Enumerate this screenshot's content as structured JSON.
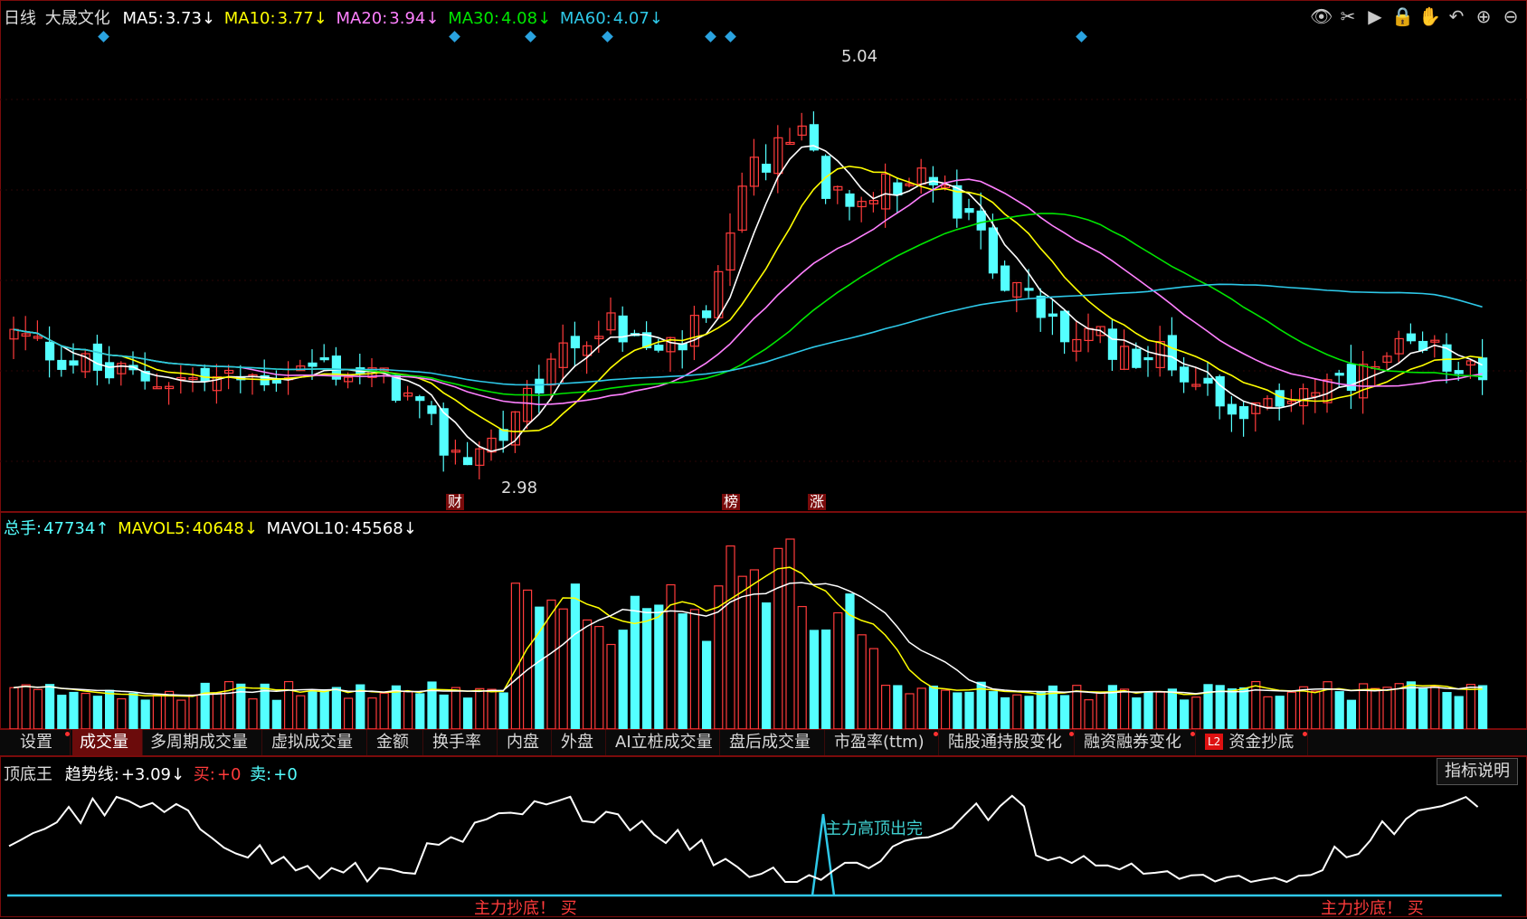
{
  "candle_header": {
    "period": "日线",
    "stock_name": "大晟文化",
    "ma5_label": "MA5:",
    "ma5_value": "3.73↓",
    "ma10_label": "MA10:",
    "ma10_value": "3.77↓",
    "ma20_label": "MA20:",
    "ma20_value": "3.94↓",
    "ma30_label": "MA30:",
    "ma30_value": "4.08↓",
    "ma60_label": "MA60:",
    "ma60_value": "4.07↓"
  },
  "candle_pane": {
    "high_label": "5.04",
    "low_label": "2.98",
    "event_tags": [
      "财",
      "榜",
      "涨"
    ]
  },
  "volume_header": {
    "total_label": "总手:",
    "total_value": "47734↑",
    "mavol5_label": "MAVOL5:",
    "mavol5_value": "40648↓",
    "mavol10_label": "MAVOL10:",
    "mavol10_value": "45568↓"
  },
  "tabs": [
    {
      "label": "设置",
      "dot": true
    },
    {
      "label": "成交量",
      "active": true
    },
    {
      "label": "多周期成交量"
    },
    {
      "label": "虚拟成交量"
    },
    {
      "label": "金额"
    },
    {
      "label": "换手率"
    },
    {
      "label": "内盘"
    },
    {
      "label": "外盘"
    },
    {
      "label": "AI立桩成交量"
    },
    {
      "label": "盘后成交量"
    },
    {
      "label": "市盈率(ttm)",
      "dot": true
    },
    {
      "label": "陆股通持股变化",
      "dot": true
    },
    {
      "label": "融资融券变化",
      "dot": true
    },
    {
      "label": "资金抄底",
      "badge": "L2",
      "dot": true
    }
  ],
  "indicator_header": {
    "name": "顶底王",
    "trend_label": "趋势线:",
    "trend_value": "+3.09↓",
    "buy_label": "买:",
    "buy_value": "+0",
    "sell_label": "卖:",
    "sell_value": "+0",
    "help_button": "指标说明"
  },
  "indicator_pane": {
    "signal_top": "主力高顶出完",
    "signal_bottom_1": "主力抄底！ 买",
    "signal_bottom_2": "主力抄底！ 买"
  },
  "toolbar_icons": [
    "eye-icon",
    "scissors-icon",
    "play-icon",
    "lock-icon",
    "hand-icon",
    "undo-icon",
    "zoom-in-icon",
    "zoom-out-icon"
  ],
  "colors": {
    "up": "#ff3b3b",
    "down": "#54ffff",
    "ma5": "#ffffff",
    "ma10": "#ffff00",
    "ma20": "#ff80ff",
    "ma30": "#00e600",
    "ma60": "#2ec8e8",
    "frame": "#7a0b0b"
  },
  "chart_data": {
    "type": "candlestick",
    "title": "大晟文化 日线",
    "price_high": 5.04,
    "price_low": 2.98,
    "ma_values": {
      "MA5": 3.73,
      "MA10": 3.77,
      "MA20": 3.94,
      "MA30": 4.08,
      "MA60": 4.07
    },
    "volume": {
      "total": 47734,
      "MAVOL5": 40648,
      "MAVOL10": 45568
    },
    "indicator": {
      "name": "顶底王",
      "trend": 3.09,
      "buy": 0,
      "sell": 0
    }
  }
}
